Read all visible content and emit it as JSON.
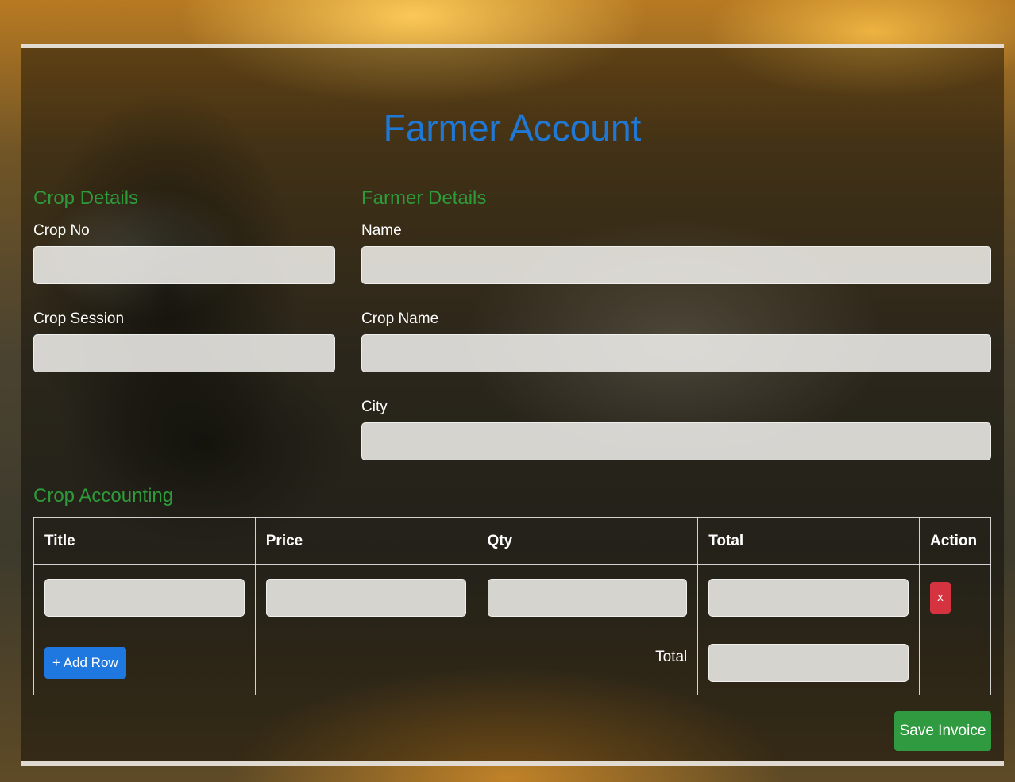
{
  "page": {
    "title": "Farmer Account"
  },
  "crop_details": {
    "heading": "Crop Details",
    "crop_no_label": "Crop No",
    "crop_no_value": "",
    "crop_session_label": "Crop Session",
    "crop_session_value": ""
  },
  "farmer_details": {
    "heading": "Farmer Details",
    "name_label": "Name",
    "name_value": "",
    "crop_name_label": "Crop Name",
    "crop_name_value": "",
    "city_label": "City",
    "city_value": ""
  },
  "accounting": {
    "heading": "Crop Accounting",
    "columns": [
      "Title",
      "Price",
      "Qty",
      "Total",
      "Action"
    ],
    "rows": [
      {
        "title": "",
        "price": "",
        "qty": "",
        "total": "",
        "remove_label": "x"
      }
    ],
    "add_row_label": "+ Add Row",
    "total_label": "Total",
    "grand_total": ""
  },
  "actions": {
    "save_label": "Save Invoice"
  },
  "colors": {
    "title": "#1f78d6",
    "section_heading": "#2e9b3a",
    "add_button": "#1f78e0",
    "remove_button": "#d63340",
    "save_button": "#2f9a3f"
  }
}
